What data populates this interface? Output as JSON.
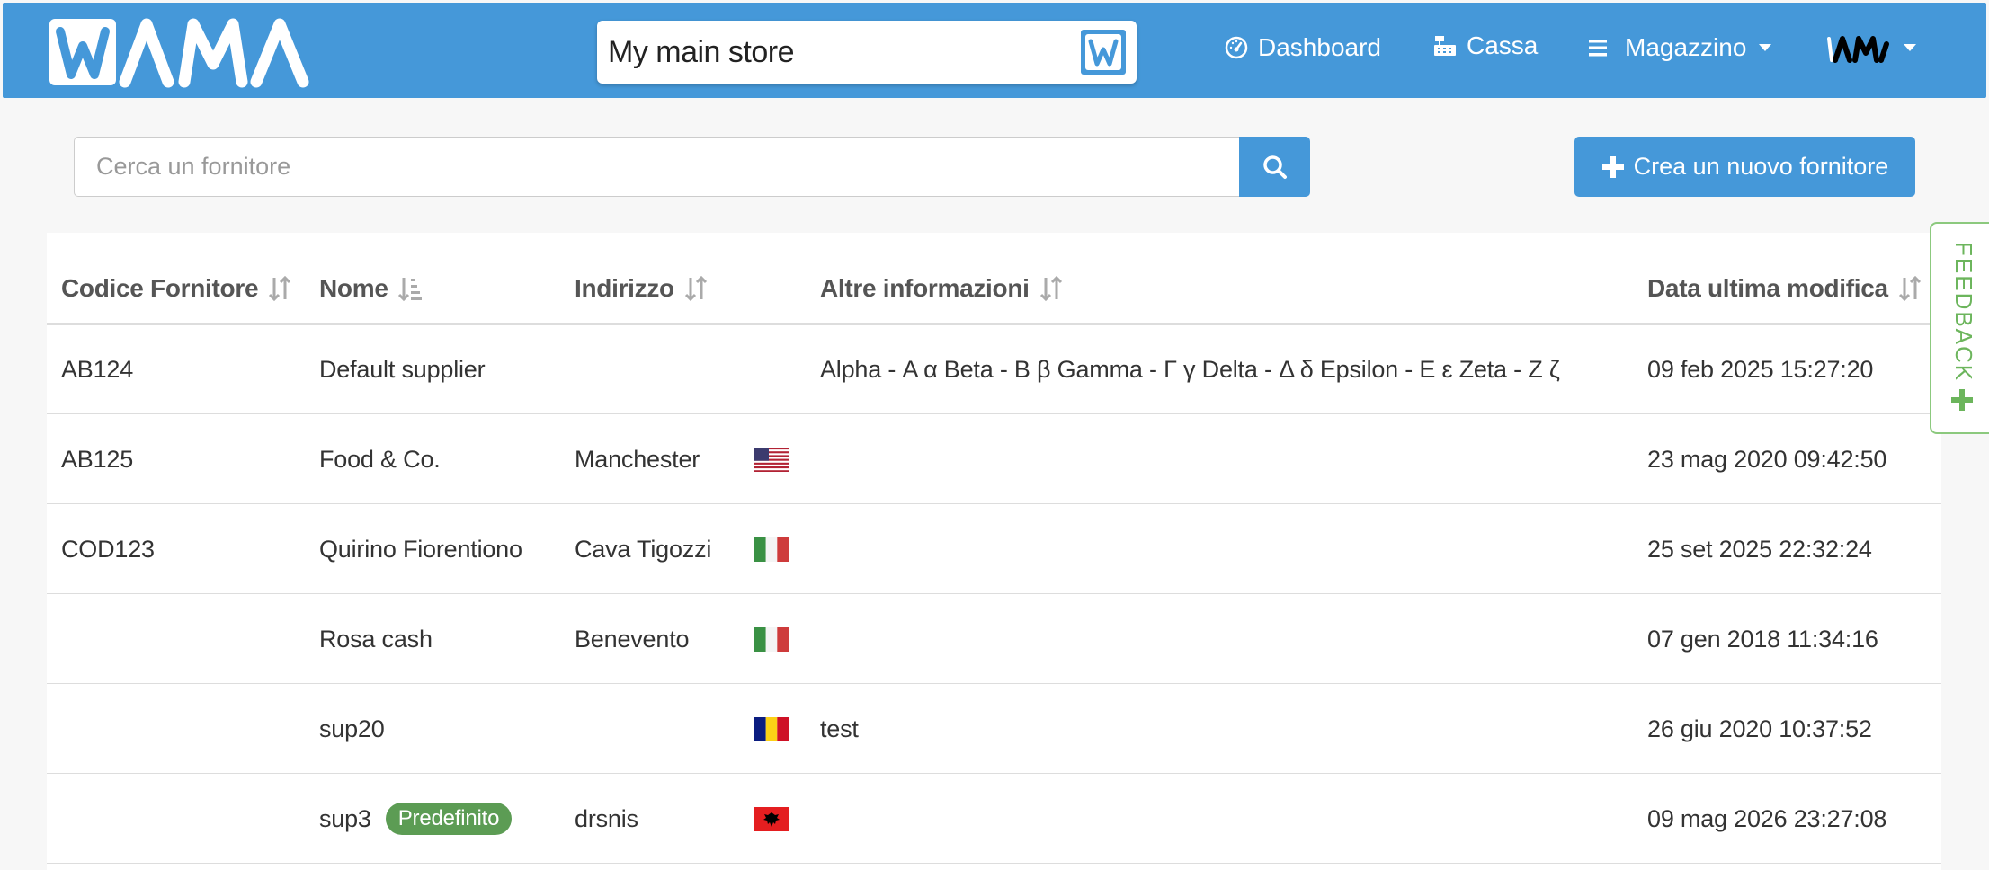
{
  "navbar": {
    "logo_text": "WAMA",
    "store_name": "My main store",
    "dashboard_label": "Dashboard",
    "cassa_label": "Cassa",
    "magazzino_label": "Magazzino",
    "user_logo_text": "WAMA",
    "color": "#4598d9"
  },
  "toolbar": {
    "search_placeholder": "Cerca un fornitore",
    "search_value": "",
    "create_label": "Crea un nuovo fornitore"
  },
  "table": {
    "headers": {
      "code": "Codice Fornitore",
      "name": "Nome",
      "address": "Indirizzo",
      "other": "Altre informazioni",
      "modified": "Data ultima modifica"
    },
    "rows": [
      {
        "code": "AB124",
        "name": "Default supplier",
        "badge": "",
        "address": "",
        "flag": "",
        "other": "Alpha - Α α Beta - Β β Gamma - Γ γ Delta - Δ δ Epsilon - Ε ε Zeta - Ζ ζ",
        "modified": "09 feb 2025 15:27:20"
      },
      {
        "code": "AB125",
        "name": "Food & Co.",
        "badge": "",
        "address": "Manchester",
        "flag": "us",
        "other": "",
        "modified": "23 mag 2020 09:42:50"
      },
      {
        "code": "COD123",
        "name": "Quirino Fiorentiono",
        "badge": "",
        "address": "Cava Tigozzi",
        "flag": "it",
        "other": "",
        "modified": "25 set 2025 22:32:24"
      },
      {
        "code": "",
        "name": "Rosa cash",
        "badge": "",
        "address": "Benevento",
        "flag": "it",
        "other": "",
        "modified": "07 gen 2018 11:34:16"
      },
      {
        "code": "",
        "name": "sup20",
        "badge": "",
        "address": "",
        "flag": "ro",
        "other": "test",
        "modified": "26 giu 2020 10:37:52"
      },
      {
        "code": "",
        "name": "sup3",
        "badge": "Predefinito",
        "address": "drsnis",
        "flag": "al",
        "other": "",
        "modified": "09 mag 2026 23:27:08"
      }
    ]
  },
  "feedback": {
    "label": "FEEDBACK"
  }
}
